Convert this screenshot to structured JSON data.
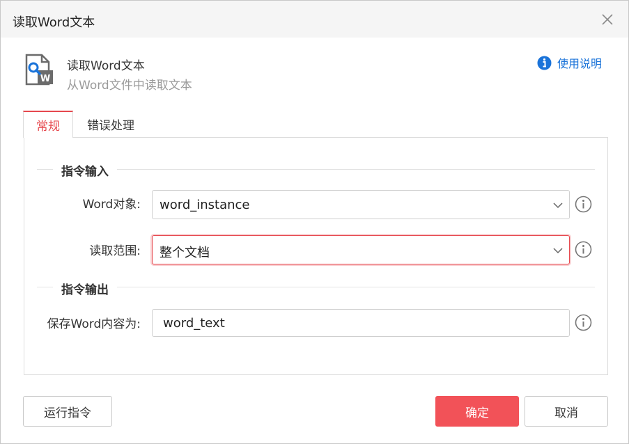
{
  "window": {
    "title": "读取Word文本"
  },
  "header": {
    "command_name": "读取Word文本",
    "command_desc": "从Word文件中读取文本",
    "help_link": "使用说明"
  },
  "tabs": [
    {
      "label": "常规",
      "active": true
    },
    {
      "label": "错误处理",
      "active": false
    }
  ],
  "sections": {
    "input_title": "指令输入",
    "output_title": "指令输出"
  },
  "fields": {
    "word_object": {
      "label": "Word对象:",
      "value": "word_instance"
    },
    "read_range": {
      "label": "读取范围:",
      "value": "整个文档"
    },
    "save_as": {
      "label": "保存Word内容为:",
      "value": "word_text"
    }
  },
  "footer": {
    "run_label": "运行指令",
    "ok_label": "确定",
    "cancel_label": "取消"
  },
  "colors": {
    "accent": "#f25258",
    "link": "#1a73d9",
    "tab_active": "#e6484e"
  },
  "icons": {
    "close": "close-icon",
    "header": "word-document-search-icon",
    "help": "info-icon",
    "dropdown": "chevron-down-icon"
  }
}
